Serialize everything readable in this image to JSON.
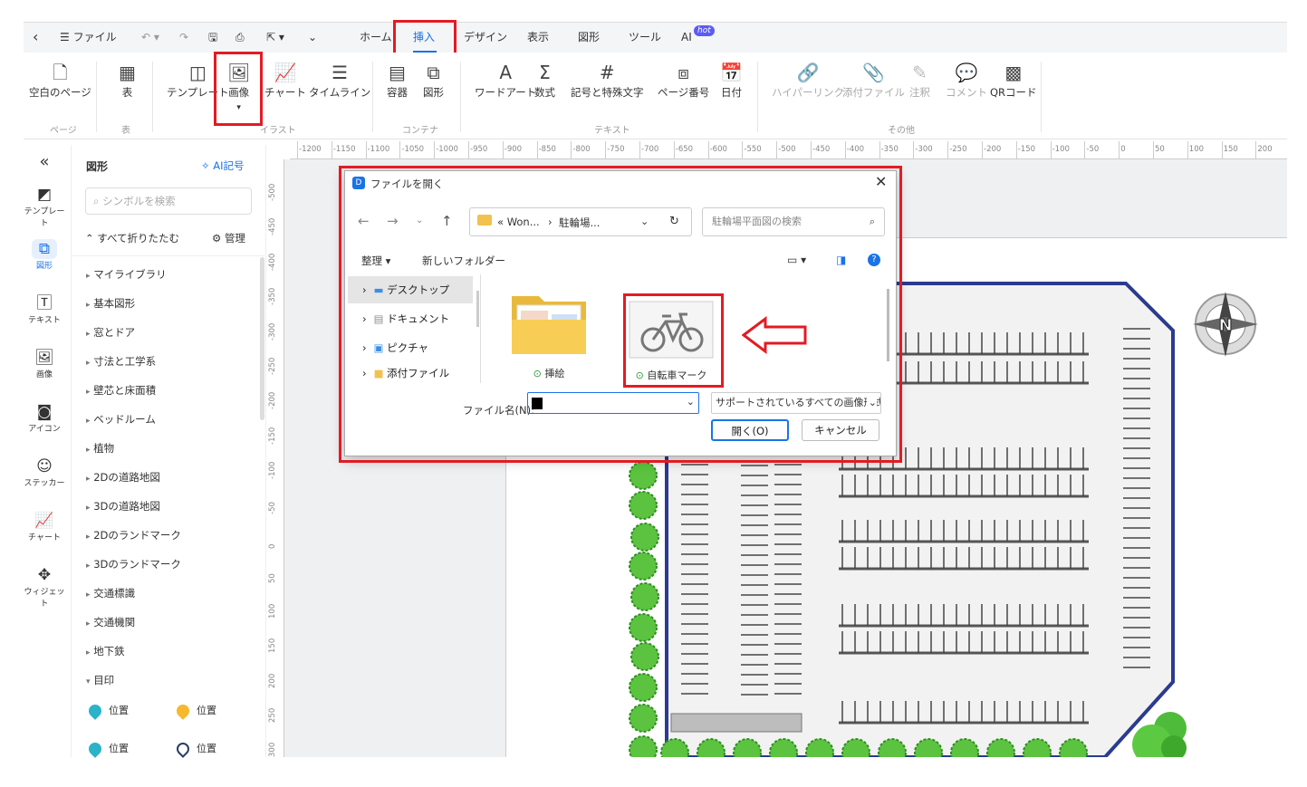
{
  "tabs": {
    "file": "ファイル",
    "home": "ホーム",
    "insert": "挿入",
    "design": "デザイン",
    "view": "表示",
    "shape": "図形",
    "tools": "ツール",
    "ai": "AI",
    "hot": "hot"
  },
  "ribbon": {
    "blank": "空白のページ",
    "table": "表",
    "template": "テンプレート",
    "image": "画像",
    "chart": "チャート",
    "timeline": "タイムライン",
    "container": "容器",
    "figure": "図形",
    "wordart": "ワードアート",
    "formula": "数式",
    "symbol": "記号と特殊文字",
    "pagenum": "ページ番号",
    "date": "日付",
    "hyperlink": "ハイパーリンク",
    "attach": "添付ファイル",
    "note": "注釈",
    "comment": "コメント",
    "qr": "QRコード",
    "groups": {
      "page": "ページ",
      "table": "表",
      "illust": "イラスト",
      "container": "コンテナ",
      "text": "テキスト",
      "other": "その他"
    }
  },
  "rail": [
    "テンプレート",
    "図形",
    "テキスト",
    "画像",
    "アイコン",
    "ステッカー",
    "チャート",
    "ウィジェット"
  ],
  "panel": {
    "title": "図形",
    "ai": "AI記号",
    "search_placeholder": "シンボルを検索",
    "collapse": "すべて折りたたむ",
    "manage": "管理",
    "libraries": [
      "マイライブラリ",
      "基本図形",
      "窓とドア",
      "寸法と工学系",
      "壁芯と床面積",
      "ベッドルーム",
      "植物",
      "2Dの道路地図",
      "3Dの道路地図",
      "2Dのランドマーク",
      "3Dのランドマーク",
      "交通標識",
      "交通機関",
      "地下鉄",
      "目印"
    ],
    "pin_label": "位置"
  },
  "hruler": [
    "-1200",
    "-1150",
    "-1100",
    "-1050",
    "-1000",
    "-950",
    "-900",
    "-850",
    "-800",
    "-750",
    "-700",
    "-650",
    "-600",
    "-550",
    "-500",
    "-450",
    "-400",
    "-350",
    "-300",
    "-250",
    "-200",
    "-150",
    "-100",
    "-50",
    "0",
    "50",
    "100",
    "150",
    "200"
  ],
  "vruler": [
    "-500",
    "-450",
    "-400",
    "-350",
    "-300",
    "-250",
    "-200",
    "-150",
    "-100",
    "-50",
    "0",
    "50",
    "100",
    "150",
    "200",
    "250",
    "300"
  ],
  "dialog": {
    "title": "ファイルを開く",
    "crumb1": "« Won...",
    "crumb2": "駐輪場...",
    "search": "駐輪場平面図の検索",
    "organize": "整理",
    "newfolder": "新しいフォルダー",
    "tree": [
      "デスクトップ",
      "ドキュメント",
      "ピクチャ",
      "添付ファイル"
    ],
    "files": [
      "挿絵",
      "自転車マーク"
    ],
    "filename_label": "ファイル名(N):",
    "filetype": "サポートされているすべての画像形式",
    "open": "開く(O)",
    "cancel": "キャンセル"
  },
  "compass": "N"
}
